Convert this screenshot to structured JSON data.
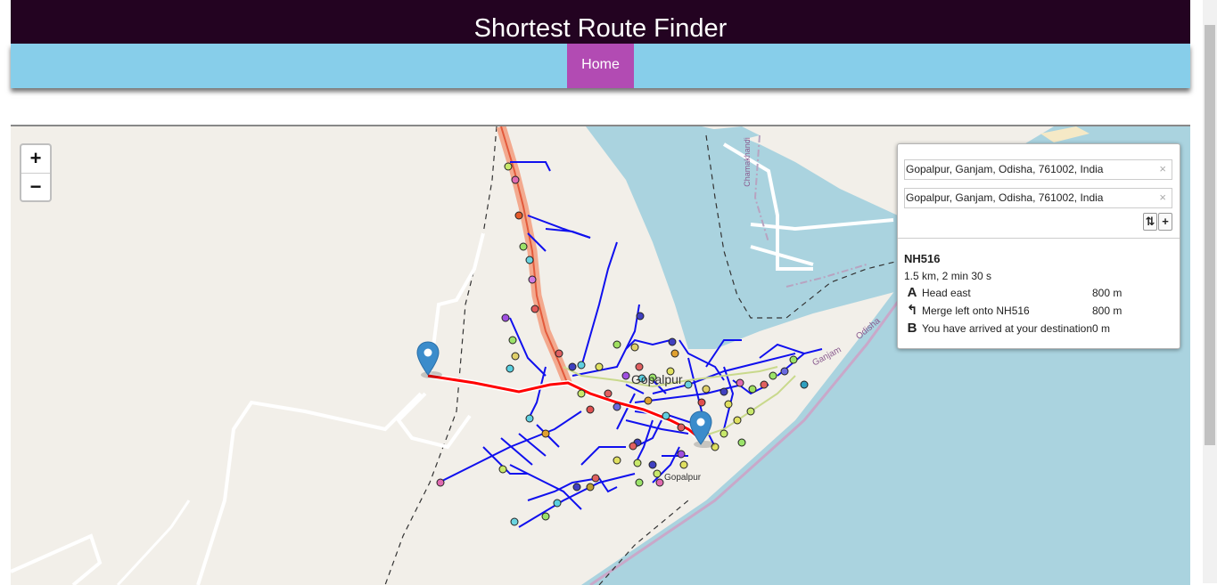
{
  "header": {
    "title": "Shortest Route Finder"
  },
  "nav": {
    "home": "Home"
  },
  "map": {
    "zoom_in": "+",
    "zoom_out": "−",
    "labels": {
      "town": "Gopalpur",
      "town_small": "Gopalpur",
      "district": "Ganjam",
      "state": "Odisha",
      "village": "Chamakhandi"
    }
  },
  "routing": {
    "waypoints": [
      "Gopalpur, Ganjam, Odisha, 761002, India",
      "Gopalpur, Ganjam, Odisha, 761002, India"
    ],
    "clear_label": "×",
    "reverse_label": "⇅",
    "add_label": "+",
    "route_name": "NH516",
    "summary": "1.5 km, 2 min 30 s",
    "instructions": [
      {
        "icon": "A",
        "text": "Head east",
        "distance": "800 m"
      },
      {
        "icon": "↰",
        "text": "Merge left onto NH516",
        "distance": "800 m"
      },
      {
        "icon": "B",
        "text": "You have arrived at your destination",
        "distance": "0 m"
      }
    ]
  },
  "colors": {
    "header_bg": "#230321",
    "nav_bg": "#87ceea",
    "nav_active": "#b24bb3",
    "water": "#aad3df",
    "land": "#f2efe9",
    "route": "#ff0000",
    "overlay_lines": "#0000ff",
    "marker": "#3b8ccb"
  }
}
